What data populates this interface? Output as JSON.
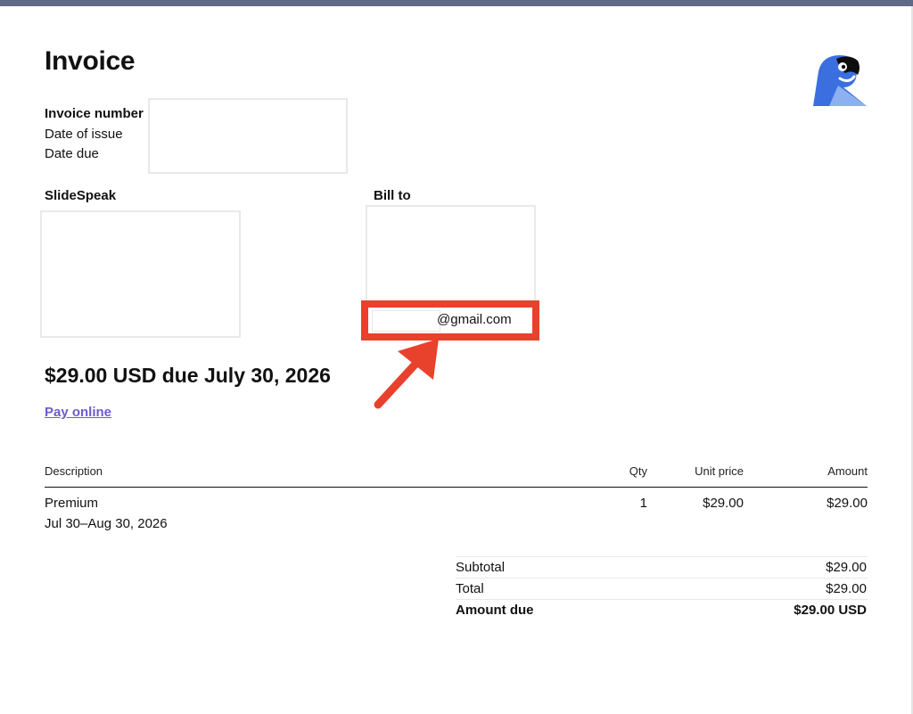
{
  "invoice": {
    "title": "Invoice",
    "meta_labels": [
      "Invoice number",
      "Date of issue",
      "Date due"
    ],
    "seller_label": "SlideSpeak",
    "bill_to_label": "Bill to",
    "bill_to_email": "@gmail.com",
    "amount_due_heading": "$29.00 USD due July 30, 2026",
    "pay_link": "Pay online",
    "logo_icon": "parrot-logo-icon"
  },
  "table": {
    "headers": {
      "description": "Description",
      "qty": "Qty",
      "unit_price": "Unit price",
      "amount": "Amount"
    },
    "rows": [
      {
        "description": "Premium",
        "period": "Jul 30–Aug 30, 2026",
        "qty": "1",
        "unit_price": "$29.00",
        "amount": "$29.00"
      }
    ]
  },
  "summary": {
    "subtotal_label": "Subtotal",
    "subtotal_value": "$29.00",
    "total_label": "Total",
    "total_value": "$29.00",
    "amount_due_label": "Amount due",
    "amount_due_value": "$29.00 USD"
  },
  "colors": {
    "top_bar": "#5f6a86",
    "highlight": "#e8412c",
    "link": "#6d5bd0",
    "logo_blue": "#3b6fe0"
  }
}
